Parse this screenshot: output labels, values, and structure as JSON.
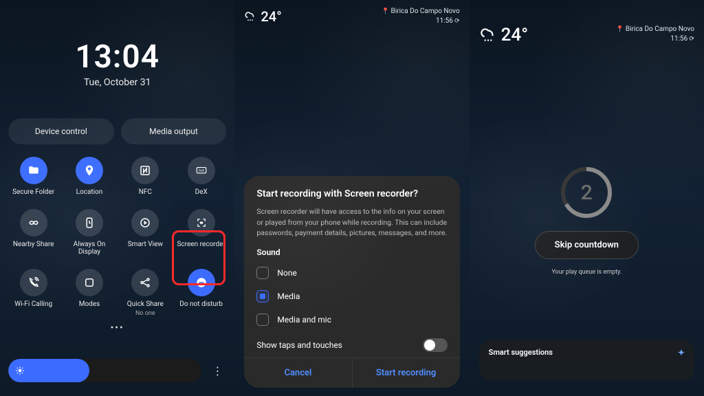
{
  "phone1": {
    "clock": {
      "time": "13:04",
      "date": "Tue, October 31"
    },
    "pills": {
      "device_control": "Device control",
      "media_output": "Media output"
    },
    "tiles": [
      {
        "id": "secure-folder",
        "label": "Secure Folder",
        "active": true
      },
      {
        "id": "location",
        "label": "Location",
        "active": true
      },
      {
        "id": "nfc",
        "label": "NFC",
        "active": false
      },
      {
        "id": "dex",
        "label": "DeX",
        "active": false
      },
      {
        "id": "nearby-share",
        "label": "Nearby Share",
        "active": false
      },
      {
        "id": "always-on-display",
        "label": "Always On Display",
        "active": false
      },
      {
        "id": "smart-view",
        "label": "Smart View",
        "active": false
      },
      {
        "id": "screen-recorder",
        "label": "Screen recorder",
        "active": false
      },
      {
        "id": "wifi-calling",
        "label": "Wi-Fi Calling",
        "active": false
      },
      {
        "id": "modes",
        "label": "Modes",
        "active": false
      },
      {
        "id": "quick-share",
        "label": "Quick Share",
        "sub": "No one",
        "active": false
      },
      {
        "id": "do-not-disturb",
        "label": "Do not disturb",
        "active": true
      }
    ],
    "brightness_pct": 42
  },
  "statusbar": {
    "temp": "24°",
    "city": "Birica Do Campo Novo",
    "time": "11:56"
  },
  "dialog": {
    "title": "Start recording with Screen recorder?",
    "body": "Screen recorder will have access to the info on your screen or played from your phone while recording. This can include passwords, payment details, pictures, messages, and more.",
    "sound_label": "Sound",
    "options": {
      "none": "None",
      "media": "Media",
      "media_mic": "Media and mic"
    },
    "selected": "media",
    "taps_label": "Show taps and touches",
    "cancel": "Cancel",
    "confirm": "Start recording"
  },
  "phone3": {
    "count": "2",
    "skip": "Skip countdown",
    "queue": "Your play queue is empty.",
    "card_title": "Smart suggestions"
  }
}
